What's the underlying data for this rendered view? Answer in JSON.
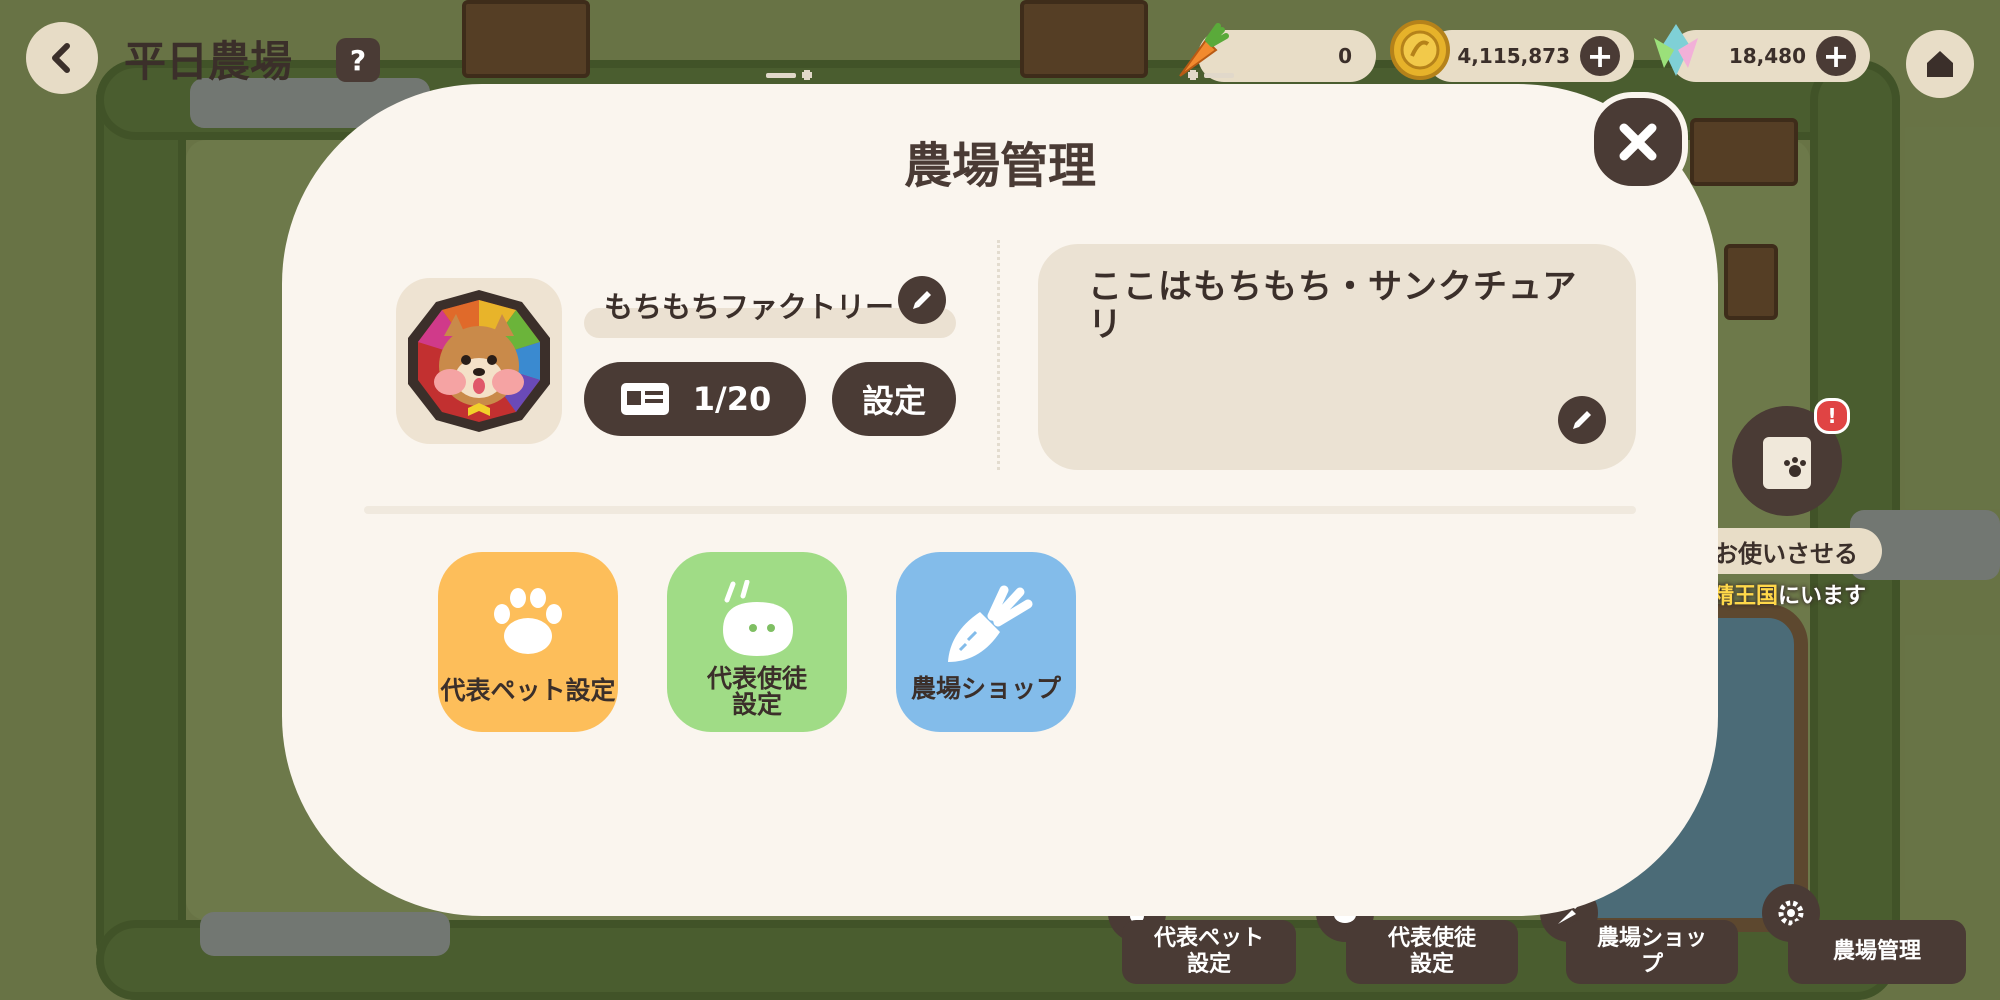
{
  "header": {
    "farm_title": "平日農場",
    "help_label": "?"
  },
  "currencies": [
    {
      "icon": "carrot-icon",
      "value": "0"
    },
    {
      "icon": "gold-coin-icon",
      "value": "4,115,873",
      "plus": "+"
    },
    {
      "icon": "crystal-icon",
      "value": "18,480",
      "plus": "+"
    }
  ],
  "side": {
    "alert_badge": "!",
    "assign_label": "お使いさせる",
    "kingdom_prefix": "",
    "kingdom_highlight": "精王国",
    "kingdom_suffix": "にいます"
  },
  "bottom_menu": [
    {
      "label_line1": "代表ペット",
      "label_line2": "設定"
    },
    {
      "label_line1": "代表使徒",
      "label_line2": "設定"
    },
    {
      "label_line1": "農場ショッ",
      "label_line2": "プ"
    },
    {
      "label_line1": "農場管理",
      "label_line2": ""
    }
  ],
  "modal": {
    "title": "農場管理",
    "close_label": "✕",
    "farm_name": "もちもちファクトリー",
    "member_count": "1/20",
    "settings_label": "設定",
    "description": "ここはもちもち・サンクチュアリ",
    "actions": [
      {
        "label_line1": "代表ペット設定",
        "label_line2": ""
      },
      {
        "label_line1": "代表使徒",
        "label_line2": "設定"
      },
      {
        "label_line1": "農場ショップ",
        "label_line2": ""
      }
    ]
  },
  "colors": {
    "dark_brown": "#4a3b35",
    "panel": "#faf5ee",
    "pet_tile": "#fdbe5a",
    "servant_tile": "#a0dc86",
    "shop_tile": "#83bcea"
  }
}
